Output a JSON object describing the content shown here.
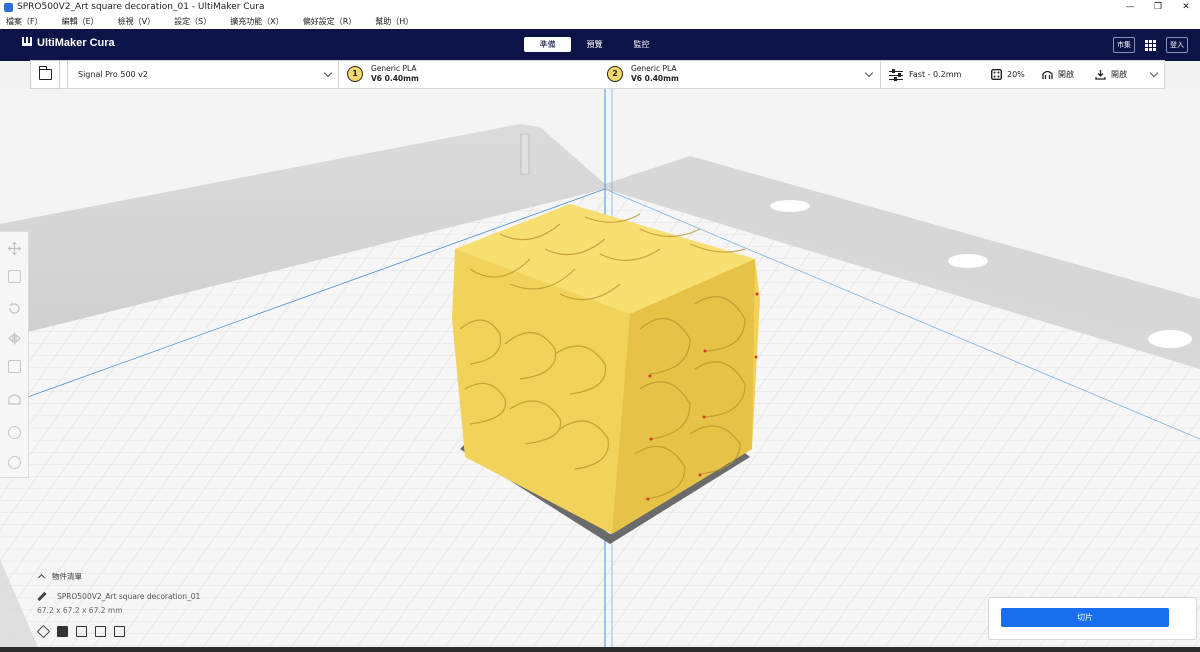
{
  "window": {
    "title": "SPRO500V2_Art square decoration_01 - UltiMaker Cura",
    "controls": [
      "—",
      "❐",
      "✕"
    ]
  },
  "menu": {
    "items": [
      "檔案（F）",
      "編輯（E）",
      "檢視（V）",
      "設定（S）",
      "擴充功能（X）",
      "偏好設定（R）",
      "幫助（H）"
    ]
  },
  "header": {
    "brand": "UltiMaker Cura",
    "tabs": [
      {
        "label": "準備",
        "active": true
      },
      {
        "label": "預覽",
        "active": false
      },
      {
        "label": "監控",
        "active": false
      }
    ],
    "marketplace_label": "市集",
    "signin_label": "登入"
  },
  "toolbar": {
    "printer": "Signal Pro 500 v2",
    "extruders": [
      {
        "number": "1",
        "material": "Generic PLA",
        "nozzle": "V6 0.40mm"
      },
      {
        "number": "2",
        "material": "Generic PLA",
        "nozzle": "V6 0.40mm"
      }
    ],
    "profile": "Fast - 0.2mm",
    "infill": "20%",
    "support": "開啟",
    "adhesion": "開啟"
  },
  "object_list": {
    "title": "物件清單",
    "object_name": "SPRO500V2_Art square decoration_01",
    "dimensions": "67.2 x 67.2 x 67.2 mm"
  },
  "slice": {
    "button_label": "切片"
  },
  "colors": {
    "header_bg": "#0c1447",
    "accent": "#196ef0",
    "model": "#f1d35c"
  }
}
